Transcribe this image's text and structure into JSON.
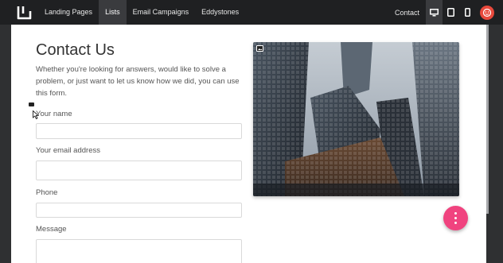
{
  "topbar": {
    "logo": "logo-icon",
    "nav": [
      {
        "label": "Landing Pages",
        "active": false
      },
      {
        "label": "Lists",
        "active": true
      },
      {
        "label": "Email Campaigns",
        "active": false
      },
      {
        "label": "Eddystones",
        "active": false
      }
    ],
    "contact": "Contact",
    "devices": [
      "desktop-icon",
      "tablet-icon",
      "mobile-icon"
    ],
    "avatar": "avatar-icon"
  },
  "page": {
    "title": "Contact Us",
    "description": "Whether you're looking for answers, would like to solve a problem, or just want to let us know how we did, you can use this form.",
    "fields": [
      {
        "label": "Your name",
        "value": ""
      },
      {
        "label": "Your email address",
        "value": ""
      },
      {
        "label": "Phone",
        "value": ""
      },
      {
        "label": "Message",
        "value": ""
      }
    ],
    "image": "skyscrapers-photo"
  },
  "colors": {
    "topbar": "#1f2022",
    "background": "#2f3032",
    "fab": "#f0437f",
    "avatar": "#e8493c"
  }
}
